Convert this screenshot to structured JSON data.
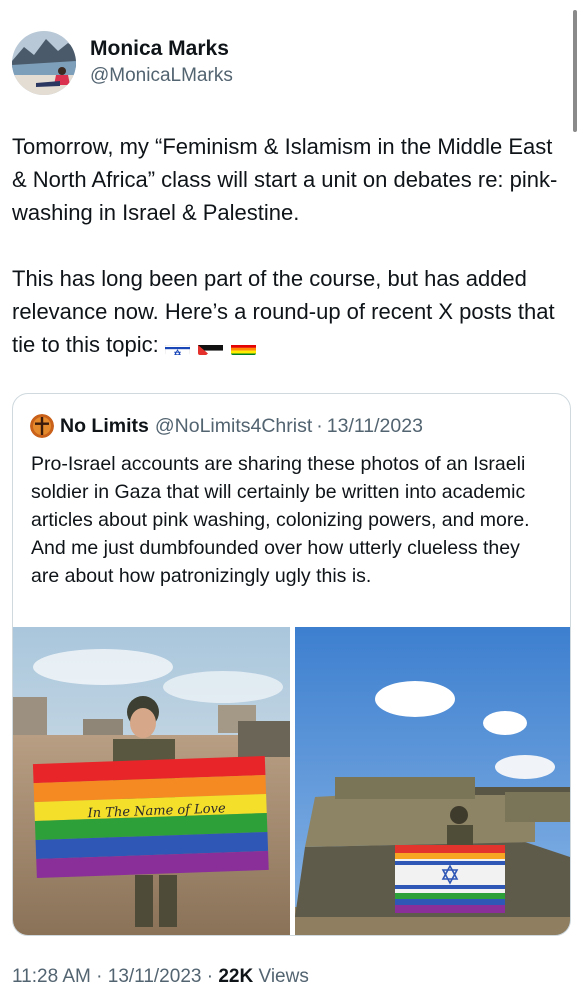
{
  "author": {
    "name": "Monica Marks",
    "handle": "@MonicaLMarks"
  },
  "tweet": {
    "paragraph1": "Tomorrow, my “Feminism & Islamism in the Middle East & North Africa” class will start a unit on debates re: pink-washing in Israel & Palestine.",
    "paragraph2": "This has long been part of the course, but has added relevance now. Here’s a round-up of recent X posts that tie to this topic:",
    "emoji": [
      "israel-flag",
      "palestine-flag",
      "rainbow-flag"
    ]
  },
  "quote": {
    "name": "No Limits",
    "handle": "@NoLimits4Christ",
    "separator": "·",
    "date": "13/11/2023",
    "text": "Pro-Israel accounts are sharing these photos of an Israeli soldier in Gaza that will certainly be written into academic articles about pink washing, colonizing powers, and more. And me just dumbfounded over how utterly clueless they are about how patronizingly ugly this is.",
    "photo1_flag_text": "In The Name of Love"
  },
  "meta": {
    "time": "11:28 AM",
    "dot1": "·",
    "date": "13/11/2023",
    "dot2": "·",
    "views_count": "22K",
    "views_label": "Views"
  }
}
